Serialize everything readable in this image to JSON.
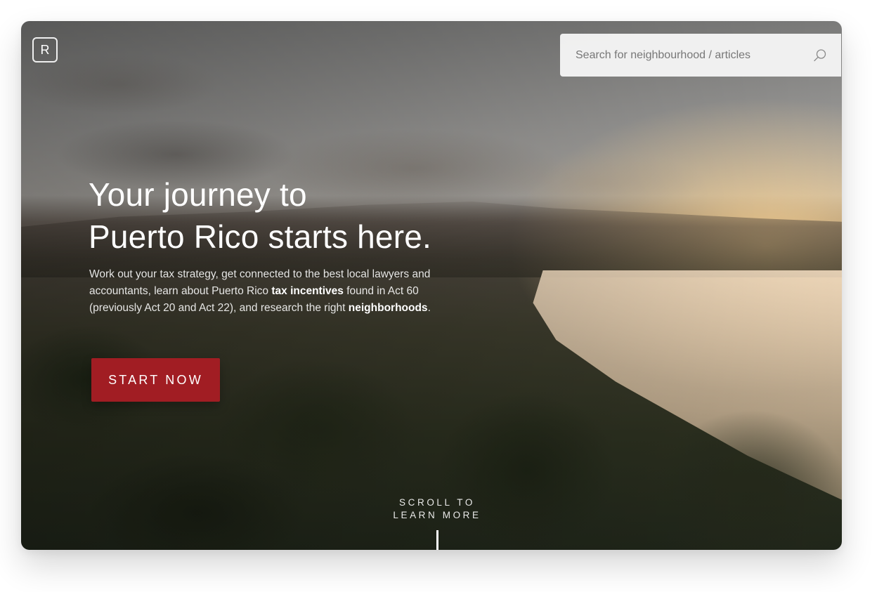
{
  "brand": {
    "logo_letter": "R"
  },
  "search": {
    "placeholder": "Search for neighbourhood / articles",
    "icon": "search-icon"
  },
  "hero": {
    "headline_line1": "Your journey to",
    "headline_line2": "Puerto Rico starts here.",
    "description": {
      "part1": "Work out your tax strategy, get connected to the best local lawyers and accountants, learn about Puerto Rico ",
      "link1": "tax incentives",
      "part2": " found in Act 60 (previously Act 20 and Act 22), and research the right ",
      "link2": "neighborhoods",
      "part3": "."
    },
    "cta_label": "START NOW",
    "scroll_line1": "SCROLL TO",
    "scroll_line2": "LEARN MORE"
  },
  "colors": {
    "accent": "#a11d23",
    "text": "#ffffff"
  }
}
